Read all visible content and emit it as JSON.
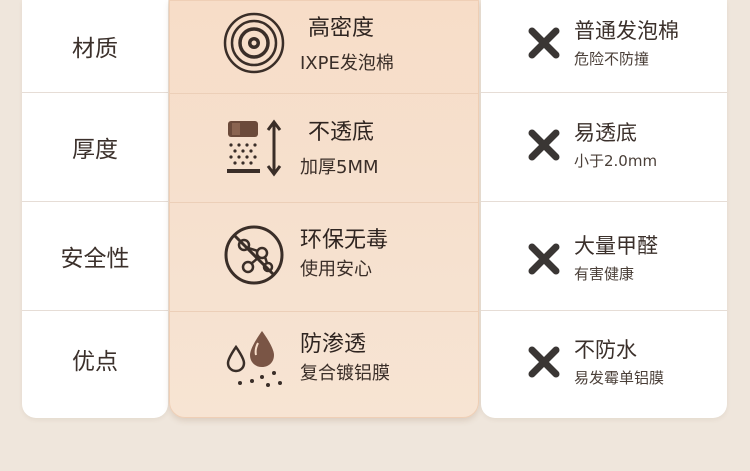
{
  "rows": [
    {
      "label": "材质",
      "ours": {
        "title": "高密度",
        "sub": "IXPE发泡棉",
        "icon": "target-foam-icon"
      },
      "theirs": {
        "title": "普通发泡棉",
        "sub": "危险不防撞",
        "icon": "x-mark-icon"
      }
    },
    {
      "label": "厚度",
      "ours": {
        "title": "不透底",
        "sub": "加厚5MM",
        "icon": "thickness-layers-icon"
      },
      "theirs": {
        "title": "易透底",
        "sub": "小于2.0mm",
        "icon": "x-mark-icon"
      }
    },
    {
      "label": "安全性",
      "ours": {
        "title": "环保无毒",
        "sub": "使用安心",
        "icon": "no-chemical-icon"
      },
      "theirs": {
        "title": "大量甲醛",
        "sub": "有害健康",
        "icon": "x-mark-icon"
      }
    },
    {
      "label": "优点",
      "ours": {
        "title": "防渗透",
        "sub": "复合镀铝膜",
        "icon": "water-drop-icon"
      },
      "theirs": {
        "title": "不防水",
        "sub": "易发霉单铝膜",
        "icon": "x-mark-icon"
      }
    }
  ],
  "colors": {
    "background": "#efe6dc",
    "highlight_column": "#f7ddc8",
    "icon_dark": "#3a2e28",
    "x_mark": "#3a3634"
  }
}
